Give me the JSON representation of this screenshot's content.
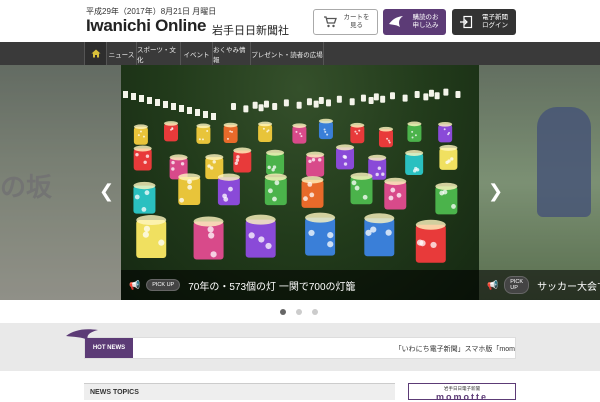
{
  "header": {
    "date": "平成29年（2017年）8月21日 月曜日",
    "logo": "Iwanichi Online",
    "logo_jp": "岩手日日新聞社",
    "cart_label": "カートを見る",
    "subscribe_label": "購読のお申し込み",
    "login_label": "電子新聞ログイン"
  },
  "nav": {
    "items": [
      "ニュース",
      "スポーツ・文化",
      "イベント",
      "おくやみ情報",
      "プレゼント・読者の広場"
    ]
  },
  "slider": {
    "left_sign": "の坂",
    "main_caption_tag": "PICK UP",
    "main_caption": "70年の・573個の灯 一関で700の灯籠",
    "right_caption_tag": "PICK UP",
    "right_caption": "サッカー大会で熱戦",
    "dots": 3,
    "active_dot": 0
  },
  "hotnews": {
    "label": "HOT NEWS",
    "text": "「いわにち電子新聞」スマホ版「mom"
  },
  "topics": {
    "title": "NEWS TOPICS"
  },
  "momotte": {
    "top": "岩手日日電子新聞",
    "brand": "momotte"
  },
  "colors": {
    "accent": "#5c3b76",
    "nav_bg": "#3a3a3a",
    "hotbar_bg": "#e9e9e9"
  }
}
